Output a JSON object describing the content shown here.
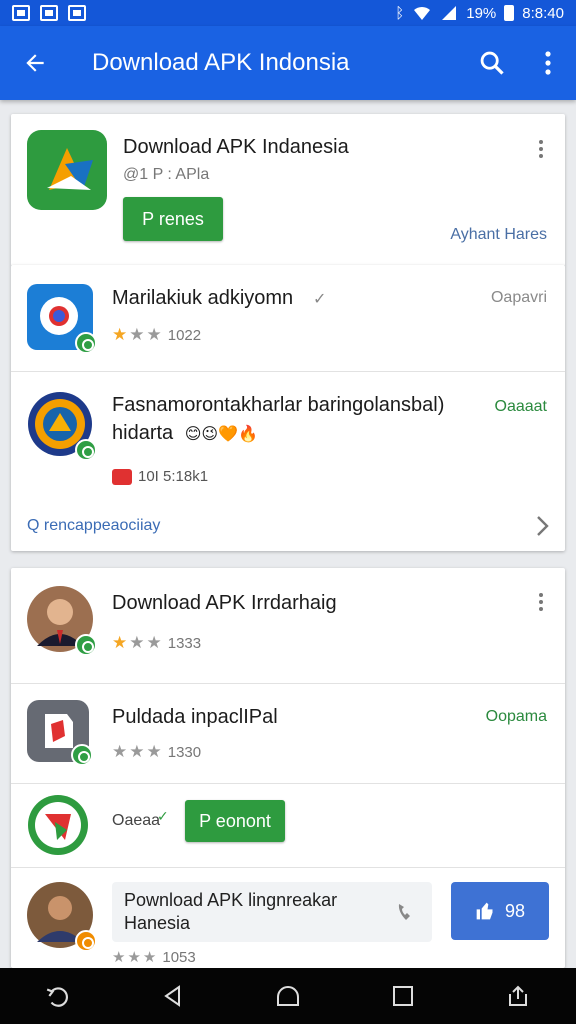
{
  "status_bar": {
    "battery": "19%",
    "time": "8:8:40"
  },
  "app_bar": {
    "title": "Download APK Indonsia"
  },
  "header_card": {
    "title": "Download APK Indanesia",
    "subtitle": "@1 P : APla",
    "button_label": "P renes",
    "link_text": "Ayhant Hares"
  },
  "list1": {
    "items": [
      {
        "title": "Marilakiuk adkiyomn",
        "status": "Oapavri",
        "rating": "1022"
      },
      {
        "title": "Fasnamorontakharlar baringolansbal)",
        "title2": "hidarta",
        "emojis": "😊😉🧡🔥",
        "status": "Oaaaat",
        "meta": "10I 5:18k1"
      }
    ],
    "footer_text": "Q rencappeaociiay"
  },
  "list2": {
    "items": [
      {
        "title": "Download APK Irrdarhaig",
        "rating": "1333"
      },
      {
        "title": "Puldada inpaclIPal",
        "status": "Oopama",
        "rating": "1330"
      },
      {
        "label": "Oaeaa",
        "button_label": "P eonont"
      },
      {
        "title": "Pownload APK lingnreakar",
        "title2": "Hanesia",
        "like_label": "98",
        "rating": "1053"
      }
    ]
  },
  "colors": {
    "primary": "#1a62e3",
    "accent_green": "#2e9b3f",
    "star": "#f5a623"
  }
}
